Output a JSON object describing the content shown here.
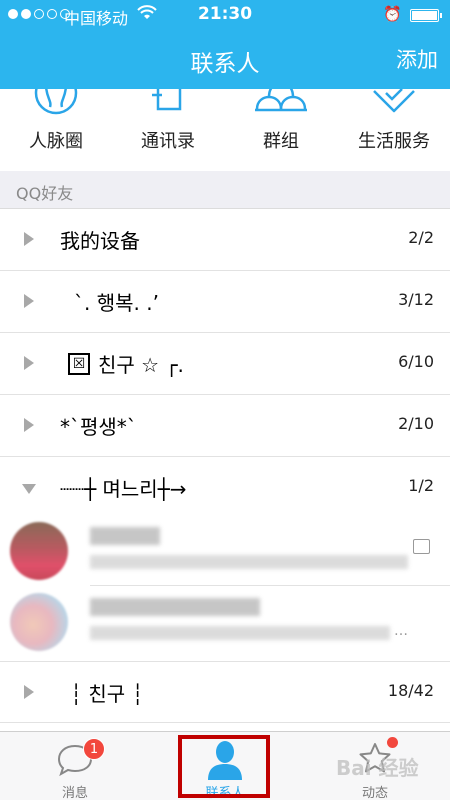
{
  "status_bar": {
    "carrier": "中国移动",
    "time": "21:30"
  },
  "header": {
    "title": "联系人",
    "add_label": "添加"
  },
  "quick_links": [
    {
      "label": "人脉圈",
      "icon": "people-circle-icon"
    },
    {
      "label": "通讯录",
      "icon": "address-book-icon"
    },
    {
      "label": "群组",
      "icon": "group-icon"
    },
    {
      "label": "生活服务",
      "icon": "life-service-icon"
    }
  ],
  "section_title": "QQ好友",
  "groups": [
    {
      "name": "我的设备",
      "count": "2/2",
      "expanded": false
    },
    {
      "name": "`. 행복. .’",
      "count": "3/12",
      "expanded": false
    },
    {
      "name": "친구 ☆ ┌.",
      "count": "6/10",
      "expanded": false
    },
    {
      "name": "*`평생*`",
      "count": "2/10",
      "expanded": false
    },
    {
      "name": "┈┈┼ 며느리┼→",
      "count": "1/2",
      "expanded": true
    },
    {
      "name": "┆ 친구 ┆",
      "count": "18/42",
      "expanded": false
    }
  ],
  "group_badge_glyph": "☒",
  "contact_ellipsis": "…",
  "tabs": [
    {
      "label": "消息",
      "badge": "1",
      "icon": "message-bubble-icon"
    },
    {
      "label": "联系人",
      "active": true,
      "icon": "contact-person-icon"
    },
    {
      "label": "动态",
      "icon": "star-icon"
    }
  ],
  "watermark": "Bai 经验",
  "colors": {
    "accent": "#2cb5ee",
    "badge": "#f2473d",
    "highlight_box": "#c00000"
  }
}
